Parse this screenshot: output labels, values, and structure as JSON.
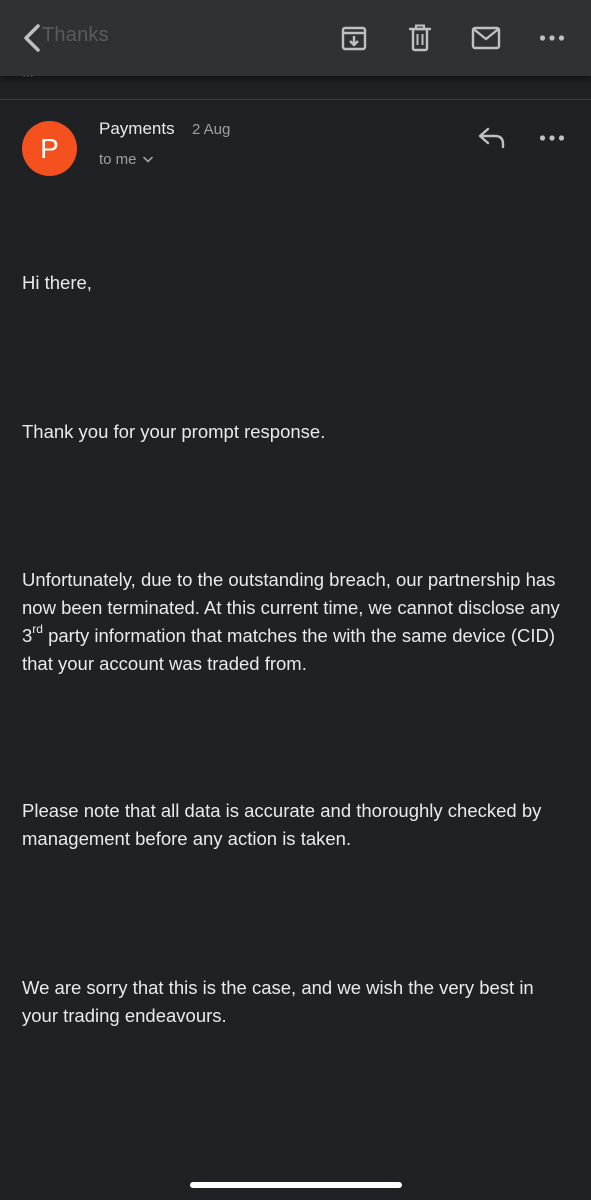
{
  "topbar": {
    "ghost_title": "Thanks",
    "ghost_subtitle": "...",
    "icons": [
      "back-chevron-icon",
      "archive-icon",
      "delete-icon",
      "mail-icon",
      "more-icon"
    ]
  },
  "message": {
    "avatar_letter": "P",
    "avatar_color": "#f4511e",
    "sender": "Payments",
    "date": "2 Aug",
    "recipient": "to me",
    "body": {
      "p1": "Hi there,",
      "p2": "Thank you for your prompt response.",
      "p3_before": "Unfortunately, due to the outstanding breach, our partnership has now been terminated. At this current time, we cannot disclose any 3",
      "p3_sup": "rd",
      "p3_after": " party information that matches the with the same device (CID) that your account was traded from.",
      "p4": "Please note that all data is accurate and thoroughly checked by management before any action is taken.",
      "p5": "We are sorry that this is the case, and we wish the very best in your trading endeavours."
    }
  },
  "colors": {
    "background": "#202124",
    "toolbar": "#303134",
    "text": "#e8eaed",
    "secondary_text": "#9aa0a6",
    "avatar": "#f4511e"
  }
}
